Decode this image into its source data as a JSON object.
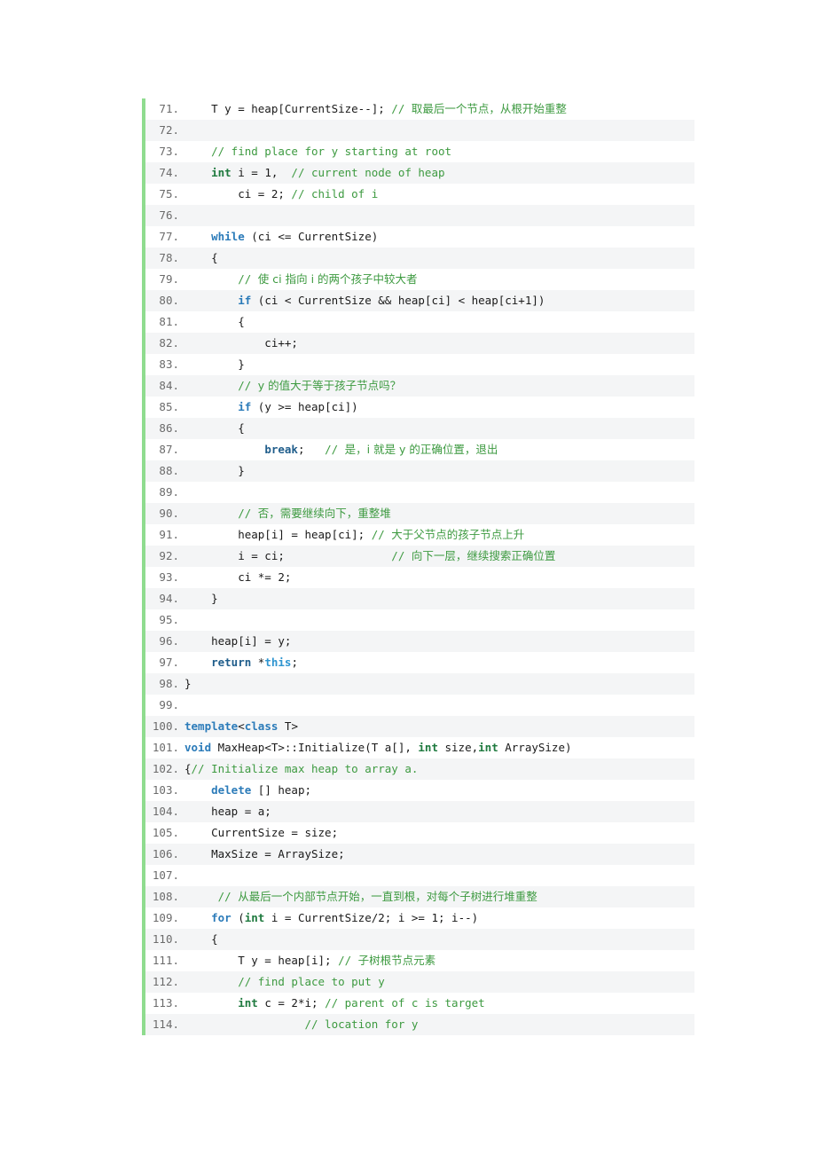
{
  "listing": {
    "language": "cpp",
    "first_line_number": 71,
    "last_line_number": 114,
    "colors": {
      "gutter_bar": "#8fdc8f",
      "row_alt_background": "#f4f5f6",
      "row_background": "#ffffff",
      "line_number": "#6b6b6b",
      "comment": "#3d9a40",
      "keyword": "#2b7bb9",
      "type_keyword": "#1f7a3f",
      "plain_text": "#1a1a1a"
    },
    "lines": [
      {
        "n": "71.",
        "tokens": [
          {
            "t": "plain",
            "v": "    T y = heap[CurrentSize--]; "
          },
          {
            "t": "comment",
            "v": "// "
          },
          {
            "t": "cjk",
            "v": "取最后一个节点，从根开始重整"
          }
        ]
      },
      {
        "n": "72.",
        "tokens": [
          {
            "t": "plain",
            "v": ""
          }
        ]
      },
      {
        "n": "73.",
        "tokens": [
          {
            "t": "comment",
            "v": "    // find place for y starting at root"
          }
        ]
      },
      {
        "n": "74.",
        "tokens": [
          {
            "t": "plain",
            "v": "    "
          },
          {
            "t": "kw2",
            "v": "int"
          },
          {
            "t": "plain",
            "v": " i = 1,  "
          },
          {
            "t": "comment",
            "v": "// current node of heap"
          }
        ]
      },
      {
        "n": "75.",
        "tokens": [
          {
            "t": "plain",
            "v": "        ci = 2; "
          },
          {
            "t": "comment",
            "v": "// child of i"
          }
        ]
      },
      {
        "n": "76.",
        "tokens": [
          {
            "t": "plain",
            "v": ""
          }
        ]
      },
      {
        "n": "77.",
        "tokens": [
          {
            "t": "plain",
            "v": "    "
          },
          {
            "t": "kw",
            "v": "while"
          },
          {
            "t": "plain",
            "v": " (ci <= CurrentSize)"
          }
        ]
      },
      {
        "n": "78.",
        "tokens": [
          {
            "t": "plain",
            "v": "    {"
          }
        ]
      },
      {
        "n": "79.",
        "tokens": [
          {
            "t": "comment",
            "v": "        // "
          },
          {
            "t": "cjk",
            "v": "使 ci 指向 i 的两个孩子中较大者"
          }
        ]
      },
      {
        "n": "80.",
        "tokens": [
          {
            "t": "plain",
            "v": "        "
          },
          {
            "t": "kw",
            "v": "if"
          },
          {
            "t": "plain",
            "v": " (ci < CurrentSize && heap[ci] < heap[ci+1])"
          }
        ]
      },
      {
        "n": "81.",
        "tokens": [
          {
            "t": "plain",
            "v": "        {"
          }
        ]
      },
      {
        "n": "82.",
        "tokens": [
          {
            "t": "plain",
            "v": "            ci++;"
          }
        ]
      },
      {
        "n": "83.",
        "tokens": [
          {
            "t": "plain",
            "v": "        }"
          }
        ]
      },
      {
        "n": "84.",
        "tokens": [
          {
            "t": "comment",
            "v": "        // "
          },
          {
            "t": "cjk",
            "v": "y 的值大于等于孩子节点吗？"
          }
        ]
      },
      {
        "n": "85.",
        "tokens": [
          {
            "t": "plain",
            "v": "        "
          },
          {
            "t": "kw",
            "v": "if"
          },
          {
            "t": "plain",
            "v": " (y >= heap[ci])"
          }
        ]
      },
      {
        "n": "86.",
        "tokens": [
          {
            "t": "plain",
            "v": "        {"
          }
        ]
      },
      {
        "n": "87.",
        "tokens": [
          {
            "t": "plain",
            "v": "            "
          },
          {
            "t": "kwdark",
            "v": "break"
          },
          {
            "t": "plain",
            "v": ";   "
          },
          {
            "t": "comment",
            "v": "// "
          },
          {
            "t": "cjk",
            "v": "是，i 就是 y 的正确位置，退出"
          }
        ]
      },
      {
        "n": "88.",
        "tokens": [
          {
            "t": "plain",
            "v": "        }"
          }
        ]
      },
      {
        "n": "89.",
        "tokens": [
          {
            "t": "plain",
            "v": ""
          }
        ]
      },
      {
        "n": "90.",
        "tokens": [
          {
            "t": "comment",
            "v": "        // "
          },
          {
            "t": "cjk",
            "v": "否，需要继续向下，重整堆"
          }
        ]
      },
      {
        "n": "91.",
        "tokens": [
          {
            "t": "plain",
            "v": "        heap[i] = heap[ci]; "
          },
          {
            "t": "comment",
            "v": "// "
          },
          {
            "t": "cjk",
            "v": "大于父节点的孩子节点上升"
          }
        ]
      },
      {
        "n": "92.",
        "tokens": [
          {
            "t": "plain",
            "v": "        i = ci;                "
          },
          {
            "t": "comment",
            "v": "// "
          },
          {
            "t": "cjk",
            "v": "向下一层，继续搜索正确位置"
          }
        ]
      },
      {
        "n": "93.",
        "tokens": [
          {
            "t": "plain",
            "v": "        ci *= 2;"
          }
        ]
      },
      {
        "n": "94.",
        "tokens": [
          {
            "t": "plain",
            "v": "    }"
          }
        ]
      },
      {
        "n": "95.",
        "tokens": [
          {
            "t": "plain",
            "v": ""
          }
        ]
      },
      {
        "n": "96.",
        "tokens": [
          {
            "t": "plain",
            "v": "    heap[i] = y;"
          }
        ]
      },
      {
        "n": "97.",
        "tokens": [
          {
            "t": "plain",
            "v": "    "
          },
          {
            "t": "kwdark",
            "v": "return"
          },
          {
            "t": "plain",
            "v": " *"
          },
          {
            "t": "this",
            "v": "this"
          },
          {
            "t": "plain",
            "v": ";"
          }
        ]
      },
      {
        "n": "98.",
        "tokens": [
          {
            "t": "plain",
            "v": "}"
          }
        ]
      },
      {
        "n": "99.",
        "tokens": [
          {
            "t": "plain",
            "v": ""
          }
        ]
      },
      {
        "n": "100.",
        "tokens": [
          {
            "t": "kw",
            "v": "template"
          },
          {
            "t": "plain",
            "v": "<"
          },
          {
            "t": "kw",
            "v": "class"
          },
          {
            "t": "plain",
            "v": " T>"
          }
        ]
      },
      {
        "n": "101.",
        "tokens": [
          {
            "t": "kw",
            "v": "void"
          },
          {
            "t": "plain",
            "v": " MaxHeap<T>::Initialize(T a[], "
          },
          {
            "t": "kw2",
            "v": "int"
          },
          {
            "t": "plain",
            "v": " size,"
          },
          {
            "t": "kw2",
            "v": "int"
          },
          {
            "t": "plain",
            "v": " ArraySize)"
          }
        ]
      },
      {
        "n": "102.",
        "tokens": [
          {
            "t": "plain",
            "v": "{"
          },
          {
            "t": "comment",
            "v": "// Initialize max heap to array a."
          }
        ]
      },
      {
        "n": "103.",
        "tokens": [
          {
            "t": "plain",
            "v": "    "
          },
          {
            "t": "kw",
            "v": "delete"
          },
          {
            "t": "plain",
            "v": " [] heap;"
          }
        ]
      },
      {
        "n": "104.",
        "tokens": [
          {
            "t": "plain",
            "v": "    heap = a;"
          }
        ]
      },
      {
        "n": "105.",
        "tokens": [
          {
            "t": "plain",
            "v": "    CurrentSize = size;"
          }
        ]
      },
      {
        "n": "106.",
        "tokens": [
          {
            "t": "plain",
            "v": "    MaxSize = ArraySize;"
          }
        ]
      },
      {
        "n": "107.",
        "tokens": [
          {
            "t": "plain",
            "v": ""
          }
        ]
      },
      {
        "n": "108.",
        "tokens": [
          {
            "t": "comment",
            "v": "     // "
          },
          {
            "t": "cjk",
            "v": "从最后一个内部节点开始，一直到根，对每个子树进行堆重整"
          }
        ]
      },
      {
        "n": "109.",
        "tokens": [
          {
            "t": "plain",
            "v": "    "
          },
          {
            "t": "kw",
            "v": "for"
          },
          {
            "t": "plain",
            "v": " ("
          },
          {
            "t": "kw2",
            "v": "int"
          },
          {
            "t": "plain",
            "v": " i = CurrentSize/2; i >= 1; i--)"
          }
        ]
      },
      {
        "n": "110.",
        "tokens": [
          {
            "t": "plain",
            "v": "    {"
          }
        ]
      },
      {
        "n": "111.",
        "tokens": [
          {
            "t": "plain",
            "v": "        T y = heap[i]; "
          },
          {
            "t": "comment",
            "v": "// "
          },
          {
            "t": "cjk",
            "v": "子树根节点元素"
          }
        ]
      },
      {
        "n": "112.",
        "tokens": [
          {
            "t": "comment",
            "v": "        // find place to put y"
          }
        ]
      },
      {
        "n": "113.",
        "tokens": [
          {
            "t": "plain",
            "v": "        "
          },
          {
            "t": "kw2",
            "v": "int"
          },
          {
            "t": "plain",
            "v": " c = 2*i; "
          },
          {
            "t": "comment",
            "v": "// parent of c is target"
          }
        ]
      },
      {
        "n": "114.",
        "tokens": [
          {
            "t": "comment",
            "v": "                  // location for y"
          }
        ]
      }
    ]
  }
}
